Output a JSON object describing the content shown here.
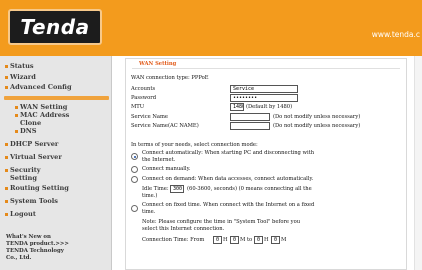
{
  "header": {
    "logo": "Tenda",
    "url": "www.tenda.c"
  },
  "sidebar": {
    "items": [
      {
        "label": "Status"
      },
      {
        "label": "Wizard"
      },
      {
        "label": "Advanced Config"
      },
      {
        "label": "WAN Setting"
      },
      {
        "label": "MAC Address"
      },
      {
        "label": "Clone"
      },
      {
        "label": "DNS"
      },
      {
        "label": "DHCP Server"
      },
      {
        "label": "Virtual Server"
      },
      {
        "label": "Security"
      },
      {
        "label": "Setting"
      },
      {
        "label": "Routing Setting"
      },
      {
        "label": "System Tools"
      },
      {
        "label": "Logout"
      }
    ],
    "footer": [
      "What's New on",
      "TENDA product.>>>",
      "TENDA Technology",
      "Co., Ltd."
    ]
  },
  "main": {
    "title": "WAN Setting",
    "connection_type_label": "WAN connection type: PPPoE",
    "account_label": "Accounts",
    "account_value": "Service",
    "password_label": "Password",
    "password_value": "••••••••",
    "mtu_label": "MTU",
    "mtu_value": "1480",
    "mtu_hint": "(Default by 1480)",
    "service_name_label": "Service Name",
    "service_name_hint": "(Do not modify unless necessary)",
    "ac_name_label": "Service Name(AC NAME)",
    "ac_name_hint": "(Do not modify unless necessary)",
    "mode_prompt": "In terms of your needs, select connection mode:",
    "mode1_line1": "Connect automatically: When starting PC and disconnecting with",
    "mode1_line2": "the Internet.",
    "mode2": "Connect manually.",
    "mode3": "Connect on demand: When data accesses, connect automatically.",
    "idle_label": "Idle Time:",
    "idle_value": "300",
    "idle_hint": "(60-3600, seconds) (0 means connecting all the",
    "idle_hint2": "time.)",
    "mode4_line1": "Connect on fixed time. When connect with the Internet on a fixed",
    "mode4_line2": "time.",
    "note_line1": "Note: Please configure the time in \"System Tool\" before you",
    "note_line2": "select this Internet connection.",
    "conn_time_label": "Connection Time: From",
    "t1": "0",
    "t2": "0",
    "t3": "0",
    "t4": "0",
    "t_h": "H",
    "t_to": "M to",
    "t_h2": "H",
    "t_m": "M"
  }
}
